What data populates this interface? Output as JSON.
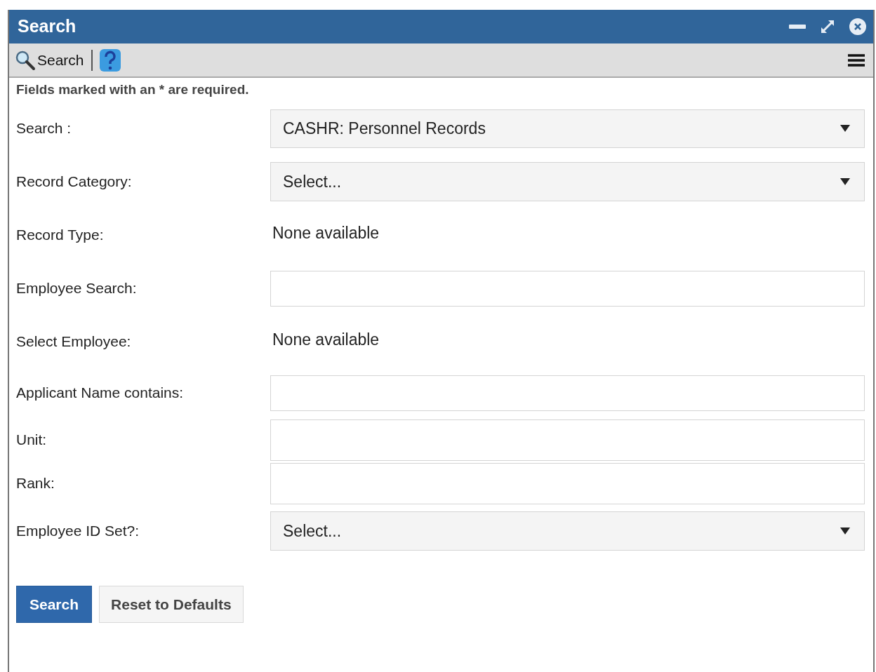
{
  "window": {
    "title": "Search"
  },
  "toolbar": {
    "search_label": "Search"
  },
  "note": "Fields marked with an * are required.",
  "fields": [
    {
      "kind": "select",
      "label": "Search :",
      "value": "CASHR: Personnel Records"
    },
    {
      "kind": "select",
      "label": "Record Category:",
      "value": "Select..."
    },
    {
      "kind": "text",
      "label": "Record Type:",
      "value": "None available"
    },
    {
      "kind": "input",
      "label": "Employee Search:"
    },
    {
      "kind": "text",
      "label": "Select Employee:",
      "value": "None available"
    },
    {
      "kind": "input",
      "label": "Applicant Name contains:"
    },
    {
      "kind": "input",
      "label": "Unit:"
    },
    {
      "kind": "input",
      "label": "Rank:"
    },
    {
      "kind": "select",
      "label": "Employee ID Set?:",
      "value": "Select..."
    }
  ],
  "buttons": [
    {
      "label": "Search",
      "primary": true
    },
    {
      "label": "Reset to Defaults",
      "primary": false
    }
  ]
}
